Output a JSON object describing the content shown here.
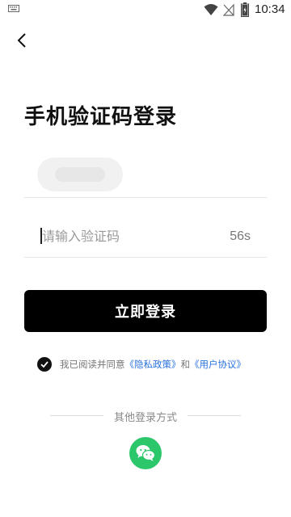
{
  "status_bar": {
    "time": "10:34"
  },
  "title": "手机验证码登录",
  "code_field": {
    "placeholder": "请输入验证码",
    "countdown": "56s"
  },
  "login_button": {
    "label": "立即登录"
  },
  "agreement": {
    "prefix": "我已阅读并同意",
    "privacy_link": "《隐私政策》",
    "and": "和",
    "user_link": "《用户协议》"
  },
  "other_login": {
    "label": "其他登录方式",
    "wechat_icon": "wechat-icon"
  },
  "colors": {
    "button": "#000000",
    "link": "#2a72e0",
    "wechat": "#2cc76a"
  }
}
